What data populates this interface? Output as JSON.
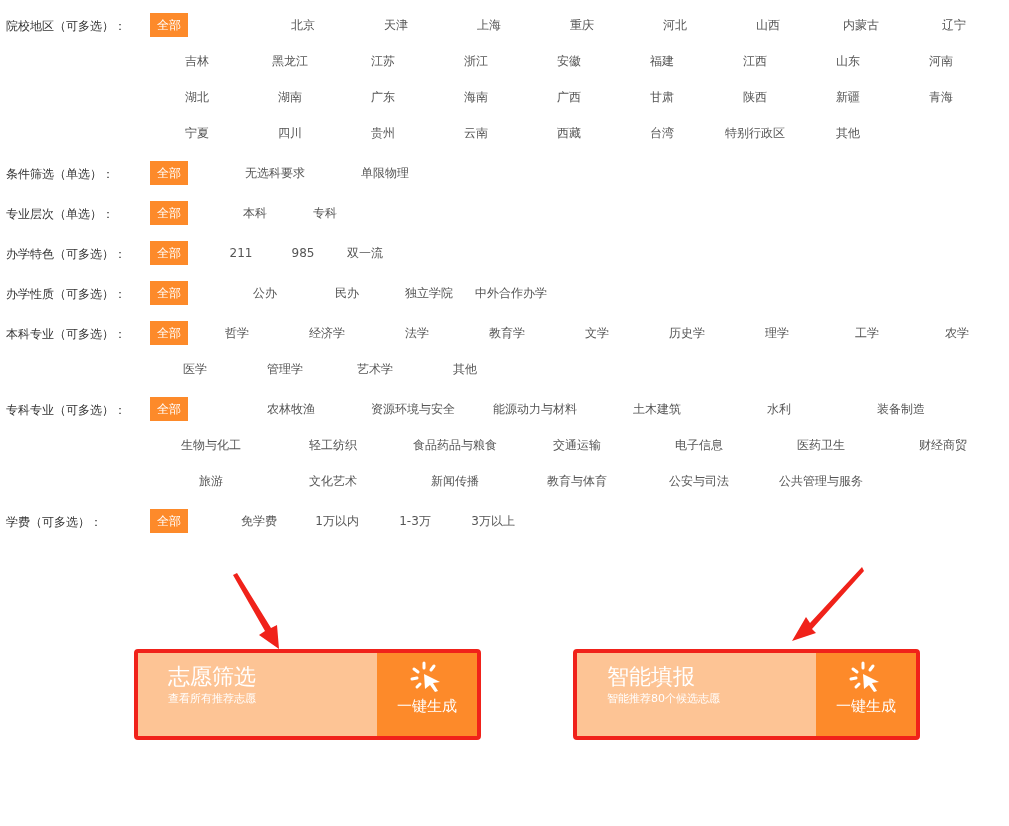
{
  "filters": [
    {
      "label": "院校地区（可多选）：",
      "options": [
        {
          "text": "全部",
          "selected": true
        },
        {
          "text": "北京",
          "selected": false
        },
        {
          "text": "天津",
          "selected": false
        },
        {
          "text": "上海",
          "selected": false
        },
        {
          "text": "重庆",
          "selected": false
        },
        {
          "text": "河北",
          "selected": false
        },
        {
          "text": "山西",
          "selected": false
        },
        {
          "text": "内蒙古",
          "selected": false
        },
        {
          "text": "辽宁",
          "selected": false
        },
        {
          "text": "吉林",
          "selected": false
        },
        {
          "text": "黑龙江",
          "selected": false
        },
        {
          "text": "江苏",
          "selected": false
        },
        {
          "text": "浙江",
          "selected": false
        },
        {
          "text": "安徽",
          "selected": false
        },
        {
          "text": "福建",
          "selected": false
        },
        {
          "text": "江西",
          "selected": false
        },
        {
          "text": "山东",
          "selected": false
        },
        {
          "text": "河南",
          "selected": false
        },
        {
          "text": "湖北",
          "selected": false
        },
        {
          "text": "湖南",
          "selected": false
        },
        {
          "text": "广东",
          "selected": false
        },
        {
          "text": "海南",
          "selected": false
        },
        {
          "text": "广西",
          "selected": false
        },
        {
          "text": "甘肃",
          "selected": false
        },
        {
          "text": "陕西",
          "selected": false
        },
        {
          "text": "新疆",
          "selected": false
        },
        {
          "text": "青海",
          "selected": false
        },
        {
          "text": "宁夏",
          "selected": false
        },
        {
          "text": "四川",
          "selected": false
        },
        {
          "text": "贵州",
          "selected": false
        },
        {
          "text": "云南",
          "selected": false
        },
        {
          "text": "西藏",
          "selected": false
        },
        {
          "text": "台湾",
          "selected": false
        },
        {
          "text": "特别行政区",
          "selected": false
        },
        {
          "text": "其他",
          "selected": false
        }
      ]
    },
    {
      "label": "条件筛选（单选）：",
      "options": [
        {
          "text": "全部",
          "selected": true
        },
        {
          "text": "无选科要求",
          "selected": false
        },
        {
          "text": "单限物理",
          "selected": false
        }
      ]
    },
    {
      "label": "专业层次（单选）：",
      "options": [
        {
          "text": "全部",
          "selected": true
        },
        {
          "text": "本科",
          "selected": false
        },
        {
          "text": "专科",
          "selected": false
        }
      ]
    },
    {
      "label": "办学特色（可多选）：",
      "options": [
        {
          "text": "全部",
          "selected": true
        },
        {
          "text": "211",
          "selected": false
        },
        {
          "text": "985",
          "selected": false
        },
        {
          "text": "双一流",
          "selected": false
        }
      ]
    },
    {
      "label": "办学性质（可多选）：",
      "options": [
        {
          "text": "全部",
          "selected": true
        },
        {
          "text": "公办",
          "selected": false
        },
        {
          "text": "民办",
          "selected": false
        },
        {
          "text": "独立学院",
          "selected": false
        },
        {
          "text": "中外合作办学",
          "selected": false
        }
      ]
    },
    {
      "label": "本科专业（可多选）：",
      "options": [
        {
          "text": "全部",
          "selected": true
        },
        {
          "text": "哲学",
          "selected": false
        },
        {
          "text": "经济学",
          "selected": false
        },
        {
          "text": "法学",
          "selected": false
        },
        {
          "text": "教育学",
          "selected": false
        },
        {
          "text": "文学",
          "selected": false
        },
        {
          "text": "历史学",
          "selected": false
        },
        {
          "text": "理学",
          "selected": false
        },
        {
          "text": "工学",
          "selected": false
        },
        {
          "text": "农学",
          "selected": false
        },
        {
          "text": "医学",
          "selected": false
        },
        {
          "text": "管理学",
          "selected": false
        },
        {
          "text": "艺术学",
          "selected": false
        },
        {
          "text": "其他",
          "selected": false
        }
      ]
    },
    {
      "label": "专科专业（可多选）：",
      "options": [
        {
          "text": "全部",
          "selected": true
        },
        {
          "text": "农林牧渔",
          "selected": false
        },
        {
          "text": "资源环境与安全",
          "selected": false
        },
        {
          "text": "能源动力与材料",
          "selected": false
        },
        {
          "text": "土木建筑",
          "selected": false
        },
        {
          "text": "水利",
          "selected": false
        },
        {
          "text": "装备制造",
          "selected": false
        },
        {
          "text": "生物与化工",
          "selected": false
        },
        {
          "text": "轻工纺织",
          "selected": false
        },
        {
          "text": "食品药品与粮食",
          "selected": false
        },
        {
          "text": "交通运输",
          "selected": false
        },
        {
          "text": "电子信息",
          "selected": false
        },
        {
          "text": "医药卫生",
          "selected": false
        },
        {
          "text": "财经商贸",
          "selected": false
        },
        {
          "text": "旅游",
          "selected": false
        },
        {
          "text": "文化艺术",
          "selected": false
        },
        {
          "text": "新闻传播",
          "selected": false
        },
        {
          "text": "教育与体育",
          "selected": false
        },
        {
          "text": "公安与司法",
          "selected": false
        },
        {
          "text": "公共管理与服务",
          "selected": false
        }
      ]
    },
    {
      "label": "学费（可多选）：",
      "options": [
        {
          "text": "全部",
          "selected": true
        },
        {
          "text": "免学费",
          "selected": false
        },
        {
          "text": "1万以内",
          "selected": false
        },
        {
          "text": "1-3万",
          "selected": false
        },
        {
          "text": "3万以上",
          "selected": false
        }
      ]
    }
  ],
  "cards": [
    {
      "title": "志愿筛选",
      "subtitle": "查看所有推荐志愿",
      "action": "一键生成"
    },
    {
      "title": "智能填报",
      "subtitle": "智能推荐80个候选志愿",
      "action": "一键生成"
    }
  ]
}
